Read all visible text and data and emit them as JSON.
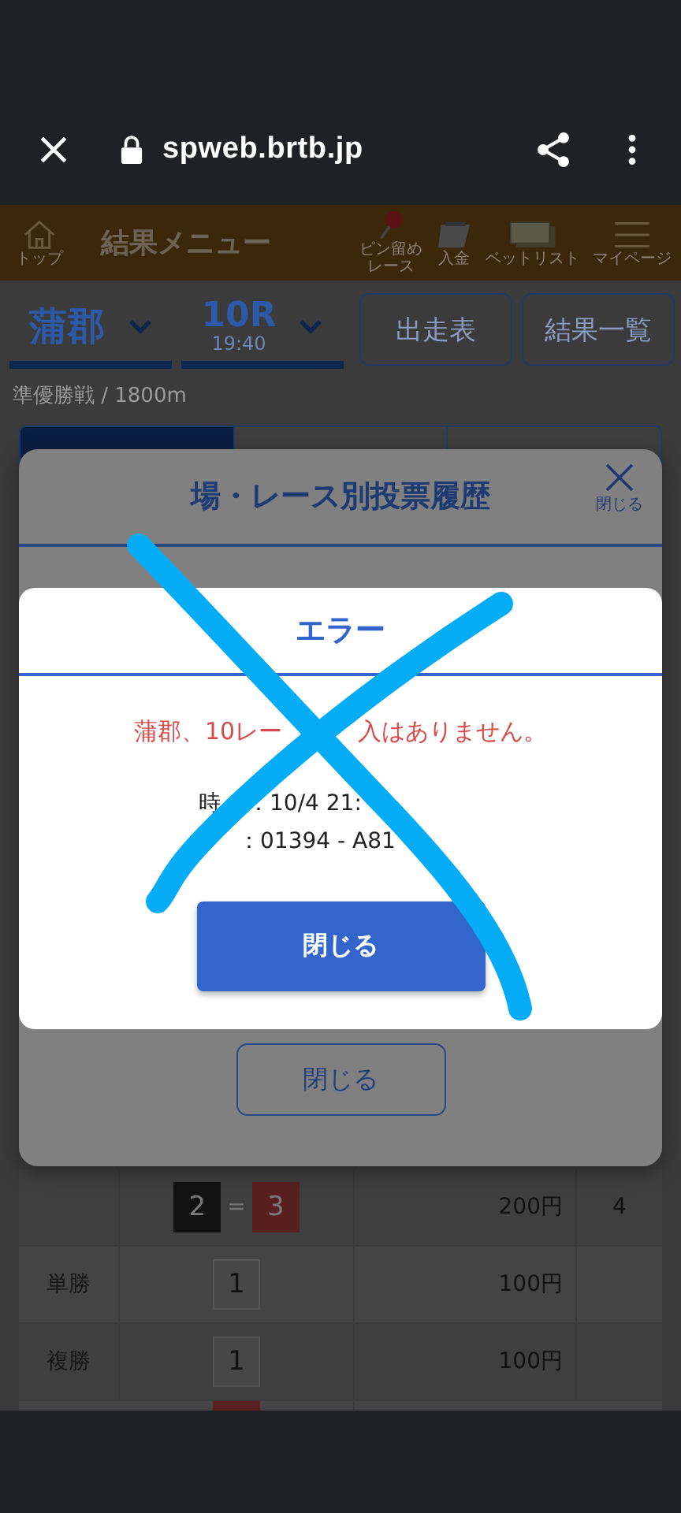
{
  "browser": {
    "url": "spweb.brtb.jp"
  },
  "header": {
    "home_label": "トップ",
    "title": "結果メニュー",
    "items": [
      {
        "kind": "pin",
        "label": "ピン留め",
        "label_2": "レース"
      },
      {
        "kind": "deposit",
        "label": "入金"
      },
      {
        "kind": "betlist",
        "label": "ベットリスト"
      },
      {
        "kind": "menu",
        "label": "マイページ"
      }
    ]
  },
  "selectors": {
    "venue": "蒲郡",
    "race": "10R",
    "time": "19:40",
    "buttons": [
      "出走表",
      "結果一覧"
    ]
  },
  "race_info": "準優勝戦 / 1800m",
  "tabs": [
    {
      "selected": true
    },
    {
      "selected": false
    },
    {
      "selected": false
    }
  ],
  "history_dialog": {
    "title": "場・レース別投票履歴",
    "close_label": "閉じる",
    "close_button": "閉じる"
  },
  "error_dialog": {
    "title": "エラー",
    "message_parts": [
      "蒲郡、10レー",
      "入はありません。"
    ],
    "details": [
      {
        "parts": [
          "時",
          "：10/4 21:"
        ]
      },
      {
        "parts": [
          "：01394 - A81"
        ]
      }
    ],
    "button": "閉じる"
  },
  "table": {
    "rows": [
      {
        "boxes": [
          {
            "number": "2",
            "color": "#121212"
          },
          {
            "number": "3",
            "color": "#5a2020"
          }
        ],
        "separator": "=",
        "amount": "200円",
        "column_4": "4"
      },
      {
        "bet_type": "単勝",
        "boxes": [
          {
            "number": "1",
            "color": "#474747"
          }
        ],
        "amount": "100円"
      },
      {
        "bet_type": "複勝",
        "boxes": [
          {
            "number": "1",
            "color": "#474747"
          }
        ],
        "amount": "100円"
      },
      {
        "boxes": [
          {
            "color": "#5a2020"
          }
        ]
      }
    ]
  }
}
